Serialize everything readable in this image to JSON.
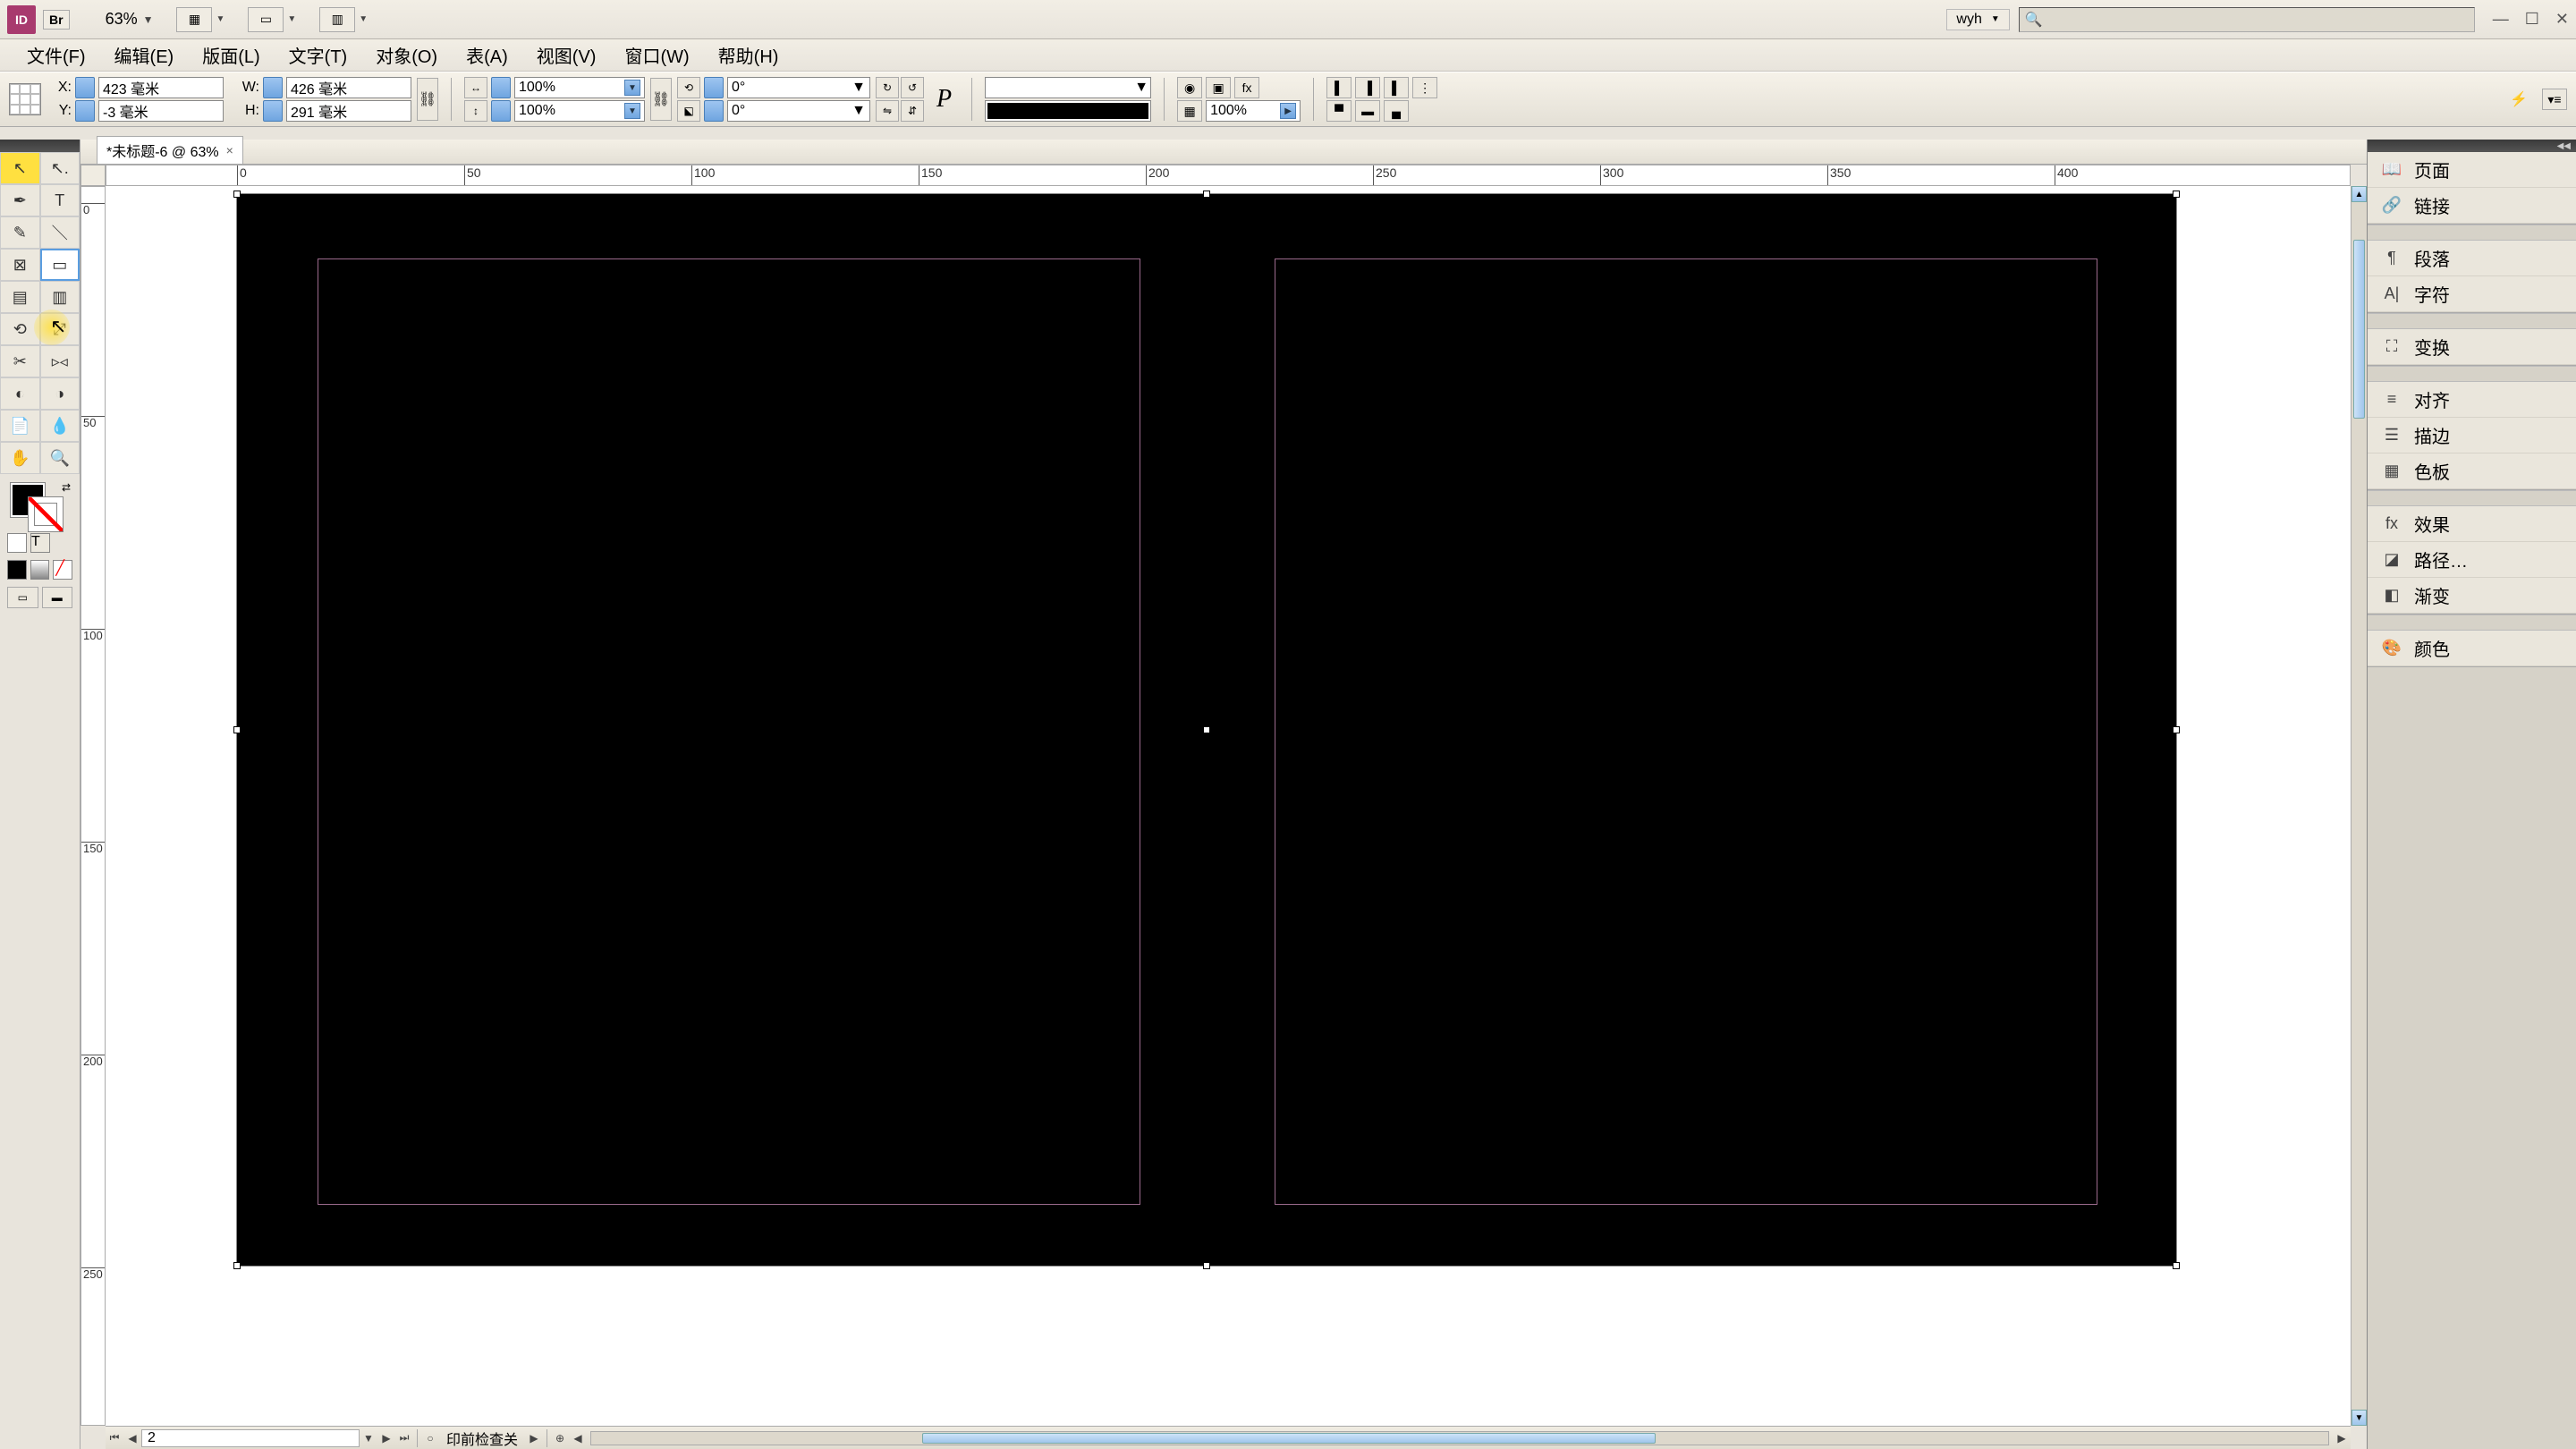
{
  "app": {
    "logo_text": "ID",
    "bridge_label": "Br",
    "zoom_value": "63%"
  },
  "user": {
    "name": "wyh"
  },
  "menu": {
    "file": "文件(F)",
    "edit": "编辑(E)",
    "layout": "版面(L)",
    "type": "文字(T)",
    "object": "对象(O)",
    "table": "表(A)",
    "view": "视图(V)",
    "window": "窗口(W)",
    "help": "帮助(H)"
  },
  "controls": {
    "x_label": "X:",
    "x_value": "423 毫米",
    "y_label": "Y:",
    "y_value": "-3 毫米",
    "w_label": "W:",
    "w_value": "426 毫米",
    "h_label": "H:",
    "h_value": "291 毫米",
    "scale_x": "100%",
    "scale_y": "100%",
    "rotate": "0°",
    "shear": "0°",
    "opacity": "100%"
  },
  "document": {
    "tab_title": "*未标题-6 @ 63%",
    "page_number": "2",
    "preflight_label": "印前检查关"
  },
  "ruler_h": [
    "0",
    "50",
    "100",
    "150",
    "200",
    "250",
    "300",
    "350",
    "400"
  ],
  "ruler_v": [
    "0",
    "50",
    "100",
    "150",
    "200",
    "250"
  ],
  "panels": {
    "pages": "页面",
    "links": "链接",
    "paragraph": "段落",
    "character": "字符",
    "transform": "变换",
    "align": "对齐",
    "stroke": "描边",
    "swatches": "色板",
    "effects": "效果",
    "pathfinder": "路径…",
    "gradient": "渐变",
    "color": "颜色"
  }
}
